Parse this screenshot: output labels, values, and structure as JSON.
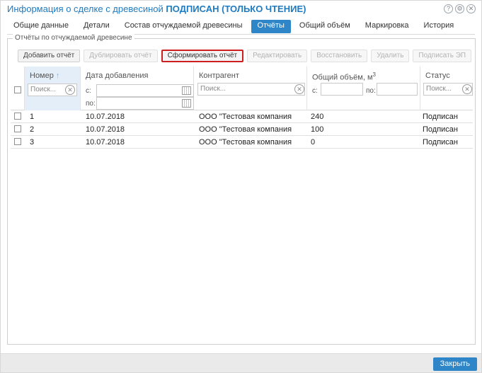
{
  "window": {
    "title_prefix": "Информация о сделке с древесиной",
    "title_status": "ПОДПИСАН",
    "title_mode": "(ТОЛЬКО ЧТЕНИЕ)",
    "icons": [
      "help-icon",
      "settings-icon",
      "close-icon"
    ]
  },
  "tabs": [
    {
      "label": "Общие данные",
      "active": false
    },
    {
      "label": "Детали",
      "active": false
    },
    {
      "label": "Состав отчуждаемой древесины",
      "active": false
    },
    {
      "label": "Отчёты",
      "active": true
    },
    {
      "label": "Общий объём",
      "active": false
    },
    {
      "label": "Маркировка",
      "active": false
    },
    {
      "label": "История",
      "active": false
    }
  ],
  "group": {
    "legend": "Отчёты по отчуждаемой древесине"
  },
  "toolbar": {
    "add": "Добавить отчёт",
    "duplicate": "Дублировать отчёт",
    "generate": "Сформировать отчёт",
    "edit": "Редактировать",
    "restore": "Восстановить",
    "delete": "Удалить",
    "sign": "Подписать ЭП"
  },
  "columns": {
    "number": "Номер",
    "date": "Дата добавления",
    "contractor": "Контрагент",
    "volume": "Общий объём, м",
    "volume_sup": "3",
    "status": "Статус"
  },
  "filters": {
    "search_placeholder": "Поиск...",
    "from_label": "с:",
    "to_label": "по:"
  },
  "rows": [
    {
      "number": "1",
      "date": "10.07.2018",
      "contractor": "ООО \"Тестовая компания",
      "volume": "240",
      "status": "Подписан"
    },
    {
      "number": "2",
      "date": "10.07.2018",
      "contractor": "ООО \"Тестовая компания",
      "volume": "100",
      "status": "Подписан"
    },
    {
      "number": "3",
      "date": "10.07.2018",
      "contractor": "ООО \"Тестовая компания",
      "volume": "0",
      "status": "Подписан"
    }
  ],
  "footer": {
    "close": "Закрыть"
  },
  "colors": {
    "accent": "#2e86c9",
    "title": "#1f7bc1",
    "highlight": "#cc1f1f"
  }
}
